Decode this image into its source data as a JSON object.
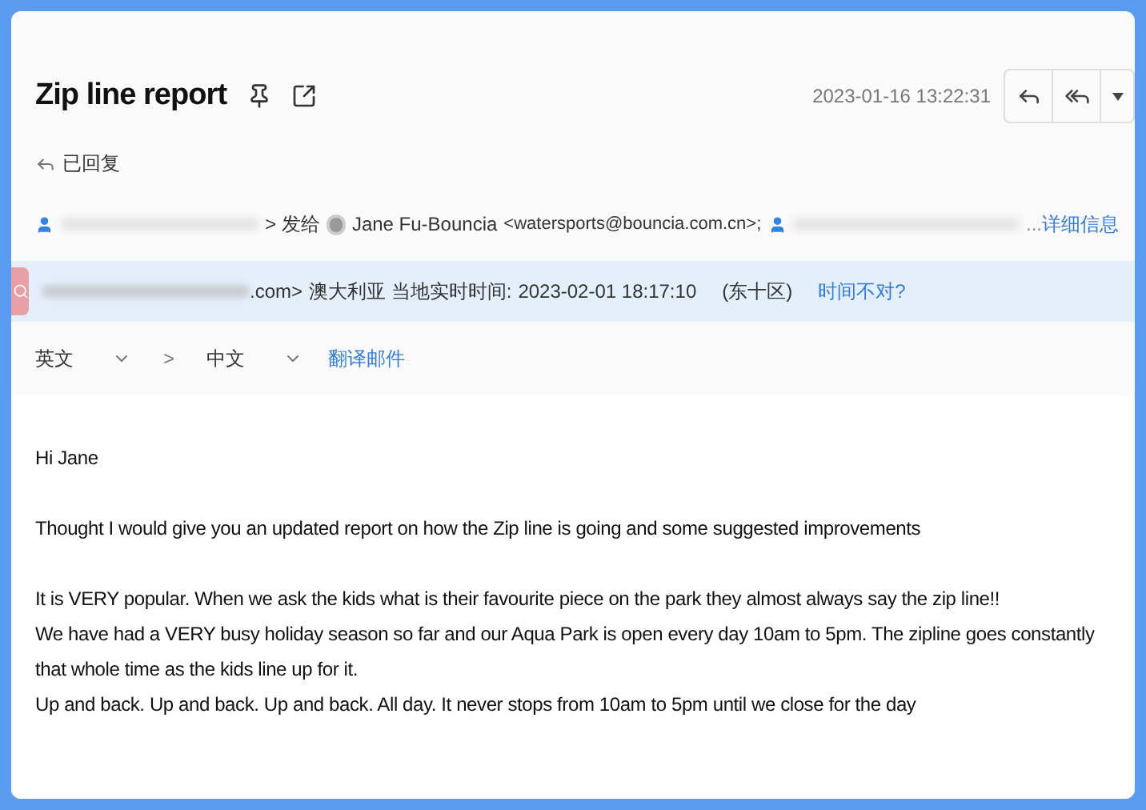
{
  "subject": "Zip line report",
  "date": "2023-01-16 13:22:31",
  "status": "已回复",
  "recipients": {
    "sent_to": "> 发给",
    "name": "Jane Fu-Bouncia",
    "email": "<watersports@bouncia.com.cn>;",
    "more": "...",
    "details_link": "详细信息"
  },
  "timezone_bar": {
    "sender_tail": ".com>",
    "label": "澳大利亚 当地实时时间:",
    "time": "2023-02-01 18:17:10",
    "zone": "(东十区)",
    "link": "时间不对?"
  },
  "translate": {
    "from": "英文",
    "to": "中文",
    "arrow": ">",
    "action": "翻译邮件"
  },
  "body": [
    [
      "Hi Jane"
    ],
    [
      "Thought I would give you an updated report on how the Zip line is going and some suggested improvements"
    ],
    [
      "It is VERY popular. When we ask the kids what is their favourite piece on the park they almost always say the zip line!!",
      "We have had a VERY busy holiday season so far and our Aqua Park is open every day 10am to 5pm. The zipline goes constantly that whole time as the kids line up for it.",
      "Up and back. Up and back. Up and back. All day. It never stops from 10am to 5pm until we close for the day"
    ]
  ]
}
